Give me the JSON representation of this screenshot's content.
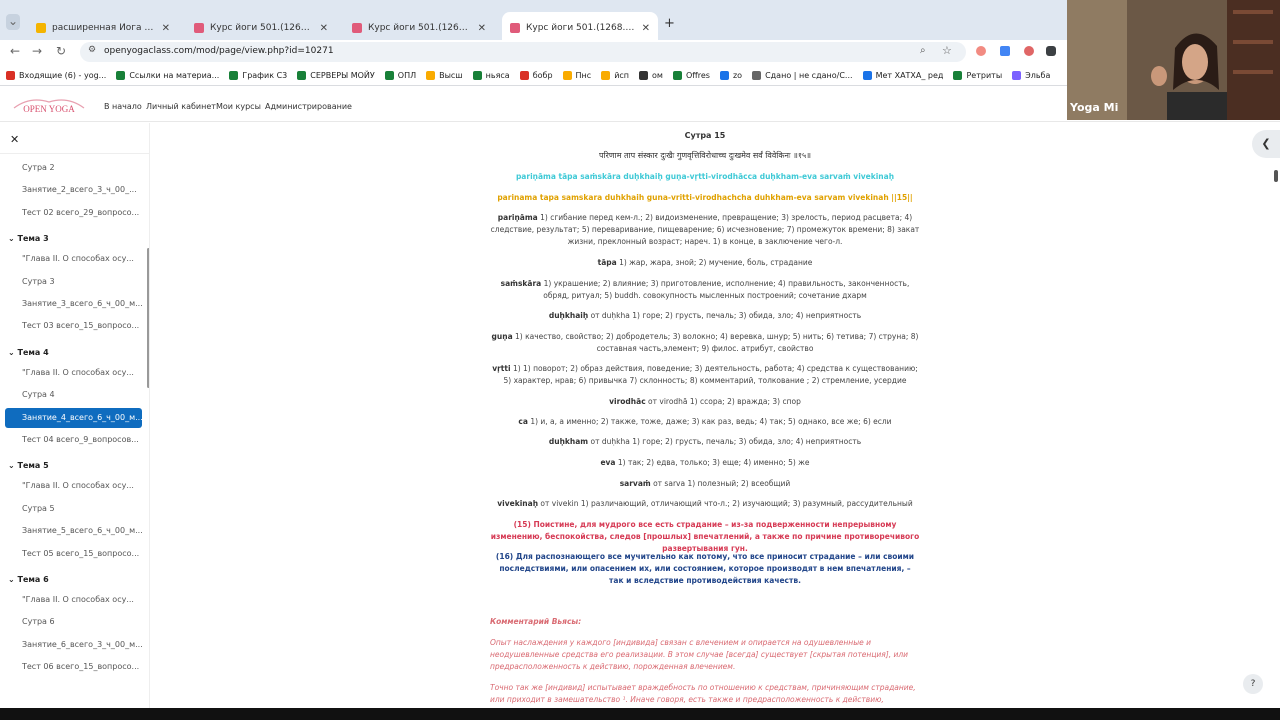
{
  "browser": {
    "tabs": [
      {
        "title": "расширенная Йога Сутры Па...",
        "color": "#f4b400",
        "active": false
      },
      {
        "title": "Курс йоги 501.(1268.208.8.1.)...",
        "color": "#e05b7a",
        "active": false
      },
      {
        "title": "Курс йоги 501.(1268.208.8.1.)...",
        "color": "#e05b7a",
        "active": false
      },
      {
        "title": "Курс йоги 501.(1268.208.8.1.)...",
        "color": "#e05b7a",
        "active": true
      }
    ],
    "new_tab": "+",
    "url": "openyogaclass.com/mod/page/view.php?id=10271",
    "bookmarks": [
      {
        "label": "Входящие (6) - yog...",
        "color": "#d93025"
      },
      {
        "label": "Ссылки на материа...",
        "color": "#188038"
      },
      {
        "label": "График С3",
        "color": "#188038"
      },
      {
        "label": "СЕРВЕРЫ МОЙУ",
        "color": "#188038"
      },
      {
        "label": "ОПЛ",
        "color": "#188038"
      },
      {
        "label": "Высш",
        "color": "#f9ab00"
      },
      {
        "label": "ньяса",
        "color": "#188038"
      },
      {
        "label": "бобр",
        "color": "#d93025"
      },
      {
        "label": "Пнс",
        "color": "#f9ab00"
      },
      {
        "label": "йсп",
        "color": "#f9ab00"
      },
      {
        "label": "ом",
        "color": "#333333"
      },
      {
        "label": "Offres",
        "color": "#188038"
      },
      {
        "label": "zo",
        "color": "#1a73e8"
      },
      {
        "label": "Сдано | не сдано/С...",
        "color": "#666666"
      },
      {
        "label": "Мет ХАТХА_ ред",
        "color": "#1a73e8"
      },
      {
        "label": "Ретриты",
        "color": "#188038"
      },
      {
        "label": "Эльба",
        "color": "#7b61ff"
      }
    ]
  },
  "site": {
    "logo": "OPEN YOGA",
    "menu": [
      "В начало",
      "Личный кабинет",
      "Мои курсы",
      "Администрирование"
    ]
  },
  "sidebar": {
    "items": [
      {
        "kind": "item",
        "label": "Сутра 2"
      },
      {
        "kind": "item",
        "label": "Занятие_2_всего_3_ч_00_..."
      },
      {
        "kind": "item",
        "label": "Тест 02 всего_29_вопросо..."
      },
      {
        "kind": "topic",
        "label": "Тема 3"
      },
      {
        "kind": "item",
        "label": "\"Глава II. О способах осу..."
      },
      {
        "kind": "item",
        "label": "Сутра 3"
      },
      {
        "kind": "item",
        "label": "Занятие_3_всего_6_ч_00_м..."
      },
      {
        "kind": "item",
        "label": "Тест 03 всего_15_вопросо..."
      },
      {
        "kind": "topic",
        "label": "Тема 4"
      },
      {
        "kind": "item",
        "label": "\"Глава II. О способах осу..."
      },
      {
        "kind": "item",
        "label": "Сутра 4"
      },
      {
        "kind": "selected",
        "label": "Занятие_4_всего_6_ч_00_м..."
      },
      {
        "kind": "item",
        "label": "Тест 04 всего_9_вопросов..."
      },
      {
        "kind": "topic",
        "label": "Тема 5"
      },
      {
        "kind": "item",
        "label": "\"Глава II. О способах осу..."
      },
      {
        "kind": "item",
        "label": "Сутра 5"
      },
      {
        "kind": "item",
        "label": "Занятие_5_всего_6_ч_00_м..."
      },
      {
        "kind": "item",
        "label": "Тест 05 всего_15_вопросо..."
      },
      {
        "kind": "topic",
        "label": "Тема 6"
      },
      {
        "kind": "item",
        "label": "\"Глава II. О способах осу..."
      },
      {
        "kind": "item",
        "label": "Сутра 6"
      },
      {
        "kind": "item",
        "label": "Занятие_6_всего_3_ч_00_м..."
      },
      {
        "kind": "item",
        "label": "Тест 06 всего_15_вопросо..."
      }
    ]
  },
  "content": {
    "title": "Сутра 15",
    "devanagari": "परिणाम ताप संस्कार दुःखैः गुणवृत्तिविरोधाच्च दुःखमेव सर्वं विवेकिनः ॥१५॥",
    "iast": "pariṇāma tāpa saṁskāra duḥkhaiḥ guṇa-vṛtti-virodhācca duḥkham-eva sarvaṁ vivekinaḥ",
    "translit": "parinama tapa samskara duhkhaih guna-vritti-virodhachcha duhkham-eva sarvam vivekinah ||15||",
    "glossary": [
      {
        "term": "pariṇāma",
        "def": "1) сгибание перед кем-л.; 2) видоизменение, превращение; 3) зрелость, период расцвета; 4) следствие, результат; 5) переваривание, пищеварение; 6) исчезновение; 7) промежуток времени; 8) закат жизни, преклонный возраст; нареч. 1) в конце, в заключение чего-л."
      },
      {
        "term": "tāpa",
        "def": "1) жар, жара, зной; 2) мучение, боль, страдание"
      },
      {
        "term": "saṁskāra",
        "def": "1) украшение; 2) влияние; 3) приготовление, исполнение; 4) правильность, законченность, обряд, ритуал; 5) buddh. совокупность мысленных построений; сочетание дхарм"
      },
      {
        "term": "duḥkhaiḥ",
        "def": "от duḥkha 1) горе; 2) грусть, печаль; 3) обида, зло; 4) неприятность"
      },
      {
        "term": "guṇa",
        "def": "1) качество, свойство; 2) добродетель; 3) волокно; 4) веревка, шнур; 5) нить; 6) тетива; 7) струна; 8) составная часть,элемент; 9) филос. атрибут, свойство"
      },
      {
        "term": "vṛtti",
        "def": "1) 1) поворот; 2) образ действия, поведение; 3) деятельность, работа; 4) средства к существованию; 5) характер, нрав; 6) привычка 7) склонность; 8) комментарий, толкование ; 2) стремление, усердие"
      },
      {
        "term": "virodhāc",
        "def": "от virodhā 1) ссора; 2) вражда; 3) спор"
      },
      {
        "term": "ca",
        "def": "1) и, а, а именно; 2) также, тоже, даже; 3) как раз, ведь; 4) так; 5) однако, все же; 6) если"
      },
      {
        "term": "duḥkham",
        "def": "от duḥkha 1) горе; 2) грусть, печаль; 3) обида, зло; 4) неприятность"
      },
      {
        "term": "eva",
        "def": "1) так; 2) едва, только; 3) еще; 4) именно; 5) же"
      },
      {
        "term": "sarvaṁ",
        "def": "от sarva 1) полезный; 2) всеобщий"
      },
      {
        "term": "vivekinaḥ",
        "def": "от vivekin 1) различающий, отличающий что-л.; 2) изучающий; 3) разумный, рассудительный"
      }
    ],
    "translation_red": "(15) Поистине, для мудрого все есть страдание – из-за подверженности непрерывному изменению, беспокойства, следов [прошлых] впечатлений, а также по причине противоречивого развертывания гун.",
    "translation_blue": "(16) Для распознающего все мучительно как потому, что все приносит страдание – или своими последствиями, или опасением их, или состоянием, которое производят в нем впечатления, – так и вследствие противодействия качеств.",
    "comment_title": "Комментарий Вьясы:",
    "comment_p1": "Опыт наслаждения у каждого [индивида] связан с влечением и опирается на одушевленные и неодушевленные средства его реализации. В этом случае [всегда] существует [скрытая потенция], или предрасположенность к действию, порожденная влечением.",
    "comment_p2": "Точно так же [индивид] испытывает враждебность по отношению к средствам, причиняющим страдание, или приходит в замешательство ¹. Иначе говоря, есть также и предрасположенность к действию,"
  },
  "overlay": {
    "webcam_label": "Yoga Mi",
    "right_panel_icon": "chevron-left-icon",
    "help_label": "?"
  }
}
